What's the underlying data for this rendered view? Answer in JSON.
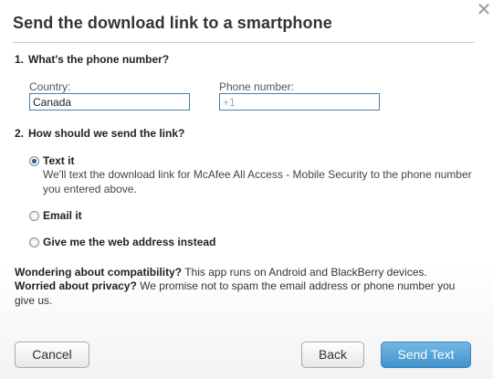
{
  "dialog": {
    "title": "Send the download link to a smartphone",
    "close_glyph": "✕"
  },
  "question1": {
    "number": "1.",
    "text": "What's the phone number?",
    "country_label": "Country:",
    "country_value": "Canada",
    "phone_label": "Phone number:",
    "phone_placeholder": "+1",
    "phone_value": ""
  },
  "question2": {
    "number": "2.",
    "text": "How should we send the link?",
    "options": [
      {
        "label": "Text it",
        "selected": true,
        "description": "We'll text the download link for McAfee All Access - Mobile Security to the phone number you entered above."
      },
      {
        "label": "Email it",
        "selected": false
      },
      {
        "label": "Give me the web address instead",
        "selected": false
      }
    ]
  },
  "notes": {
    "compat_heading": "Wondering about compatibility?",
    "compat_text": " This app runs on Android and BlackBerry devices.",
    "privacy_heading": "Worried about privacy?",
    "privacy_text": " We promise not to spam the email address or phone number you give us."
  },
  "buttons": {
    "cancel": "Cancel",
    "back": "Back",
    "send": "Send Text"
  },
  "colors": {
    "accent": "#3f93cc",
    "input_border": "#4b7f9d"
  },
  "icons": {
    "close": "close-icon"
  }
}
